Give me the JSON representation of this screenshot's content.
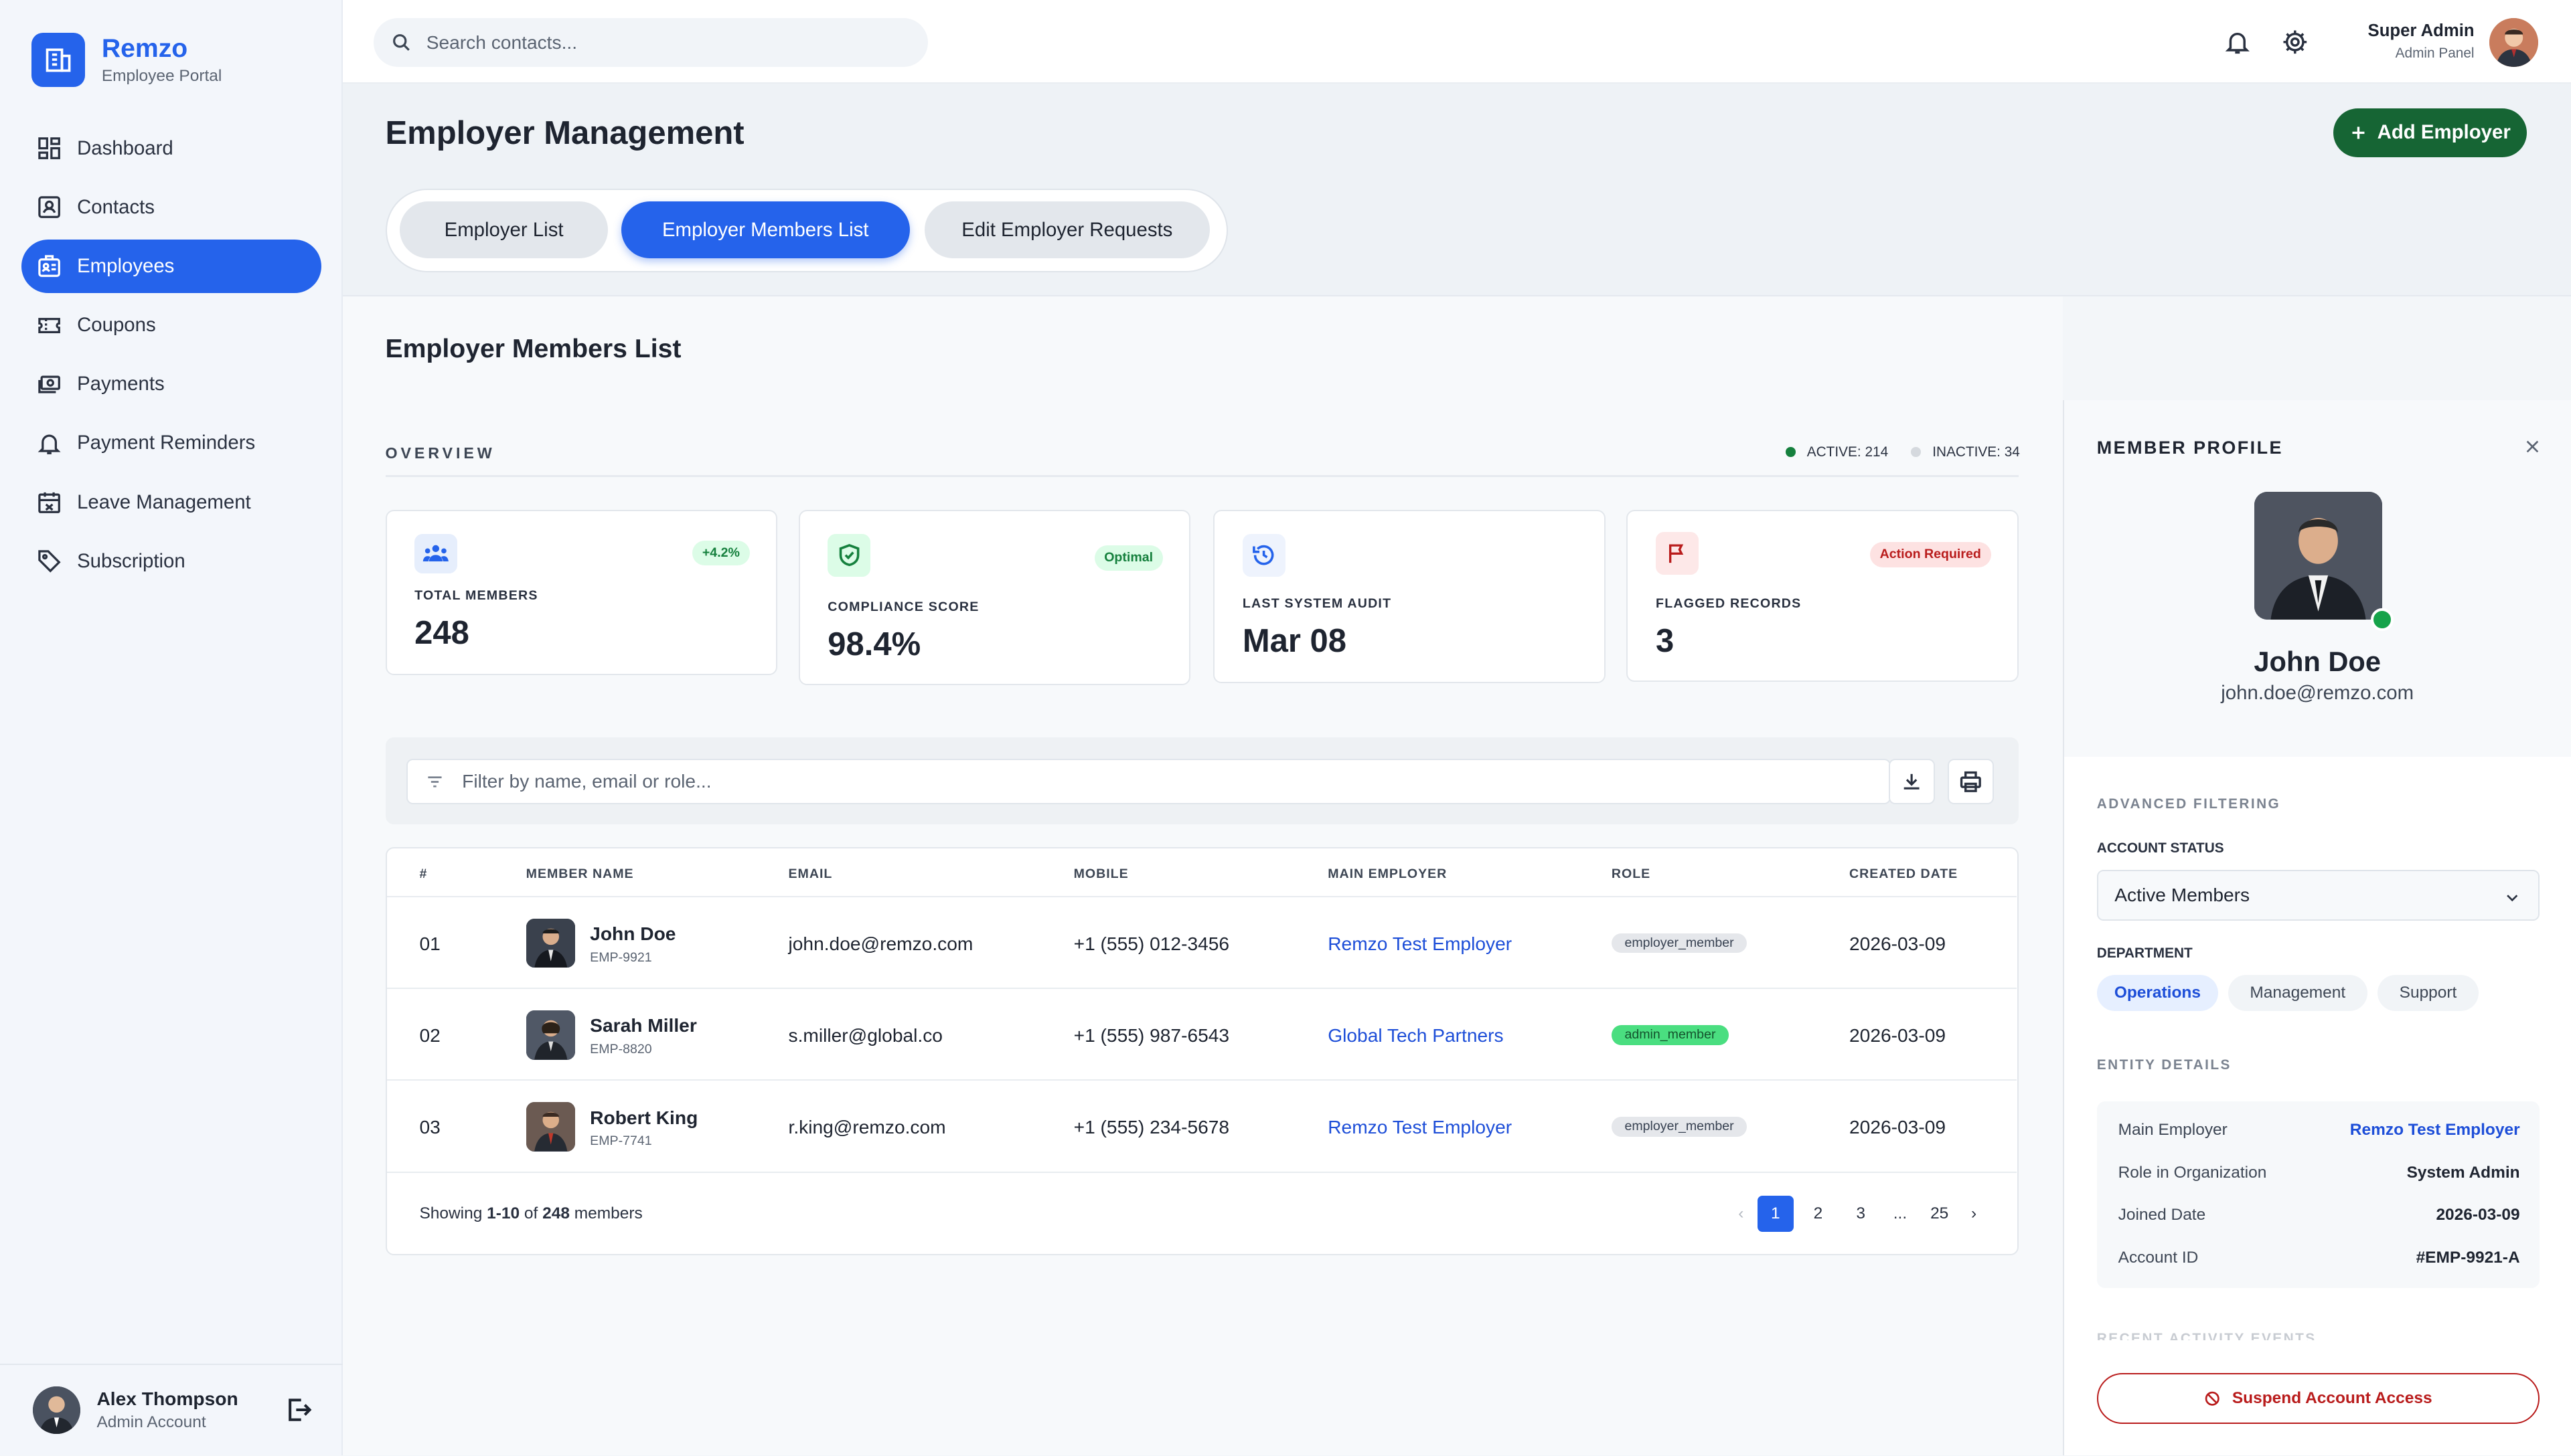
{
  "brand": {
    "name": "Remzo",
    "subtitle": "Employee Portal"
  },
  "sidebar": {
    "items": [
      {
        "label": "Dashboard",
        "icon": "dashboard-icon"
      },
      {
        "label": "Contacts",
        "icon": "contacts-icon"
      },
      {
        "label": "Employees",
        "icon": "employees-icon",
        "active": true
      },
      {
        "label": "Coupons",
        "icon": "coupon-icon"
      },
      {
        "label": "Payments",
        "icon": "payments-icon"
      },
      {
        "label": "Payment Reminders",
        "icon": "bell-icon"
      },
      {
        "label": "Leave Management",
        "icon": "calendar-icon"
      },
      {
        "label": "Subscription",
        "icon": "tag-icon"
      }
    ],
    "user": {
      "name": "Alex Thompson",
      "role": "Admin Account"
    }
  },
  "topbar": {
    "search_placeholder": "Search contacts...",
    "admin_name": "Super Admin",
    "admin_role": "Admin Panel"
  },
  "header": {
    "title": "Employer Management",
    "add_button": "Add Employer",
    "tabs": [
      {
        "label": "Employer List"
      },
      {
        "label": "Employer Members List",
        "active": true
      },
      {
        "label": "Edit Employer Requests"
      }
    ]
  },
  "main": {
    "section_title": "Employer Members List",
    "overview_label": "OVERVIEW",
    "active_count": "ACTIVE: 214",
    "inactive_count": "INACTIVE: 34",
    "cards": [
      {
        "label": "TOTAL MEMBERS",
        "value": "248",
        "badge": "+4.2%"
      },
      {
        "label": "COMPLIANCE SCORE",
        "value": "98.4%",
        "badge": "Optimal"
      },
      {
        "label": "LAST SYSTEM AUDIT",
        "value": "Mar 08",
        "badge": ""
      },
      {
        "label": "FLAGGED RECORDS",
        "value": "3",
        "badge": "Action Required"
      }
    ],
    "filter_placeholder": "Filter by name, email or role...",
    "table": {
      "headers": [
        "#",
        "MEMBER NAME",
        "EMAIL",
        "MOBILE",
        "MAIN EMPLOYER",
        "ROLE",
        "CREATED DATE"
      ],
      "rows": [
        {
          "num": "01",
          "name": "John Doe",
          "id": "EMP-9921",
          "email": "john.doe@remzo.com",
          "mobile": "+1 (555) 012-3456",
          "employer": "Remzo Test Employer",
          "role": "employer_member",
          "created": "2026-03-09"
        },
        {
          "num": "02",
          "name": "Sarah Miller",
          "id": "EMP-8820",
          "email": "s.miller@global.co",
          "mobile": "+1 (555) 987-6543",
          "employer": "Global Tech Partners",
          "role": "admin_member",
          "created": "2026-03-09"
        },
        {
          "num": "03",
          "name": "Robert King",
          "id": "EMP-7741",
          "email": "r.king@remzo.com",
          "mobile": "+1 (555) 234-5678",
          "employer": "Remzo Test Employer",
          "role": "employer_member",
          "created": "2026-03-09"
        }
      ],
      "footer": {
        "prefix": "Showing ",
        "range": "1-10",
        "mid": " of ",
        "total": "248",
        "suffix": " members"
      },
      "pages": [
        "1",
        "2",
        "3",
        "...",
        "25"
      ]
    }
  },
  "panel": {
    "title": "MEMBER PROFILE",
    "name": "John Doe",
    "email": "john.doe@remzo.com",
    "advanced_label": "ADVANCED FILTERING",
    "account_status_label": "ACCOUNT STATUS",
    "account_status_value": "Active Members",
    "department_label": "DEPARTMENT",
    "departments": [
      "Operations",
      "Management",
      "Support"
    ],
    "entity_label": "ENTITY DETAILS",
    "entity": [
      {
        "key": "Main Employer",
        "value": "Remzo Test Employer"
      },
      {
        "key": "Role in Organization",
        "value": "System Admin"
      },
      {
        "key": "Joined Date",
        "value": "2026-03-09"
      },
      {
        "key": "Account ID",
        "value": "#EMP-9921-A"
      }
    ],
    "faded_label": "RECENT ACTIVITY EVENTS",
    "suspend_button": "Suspend Account Access"
  }
}
